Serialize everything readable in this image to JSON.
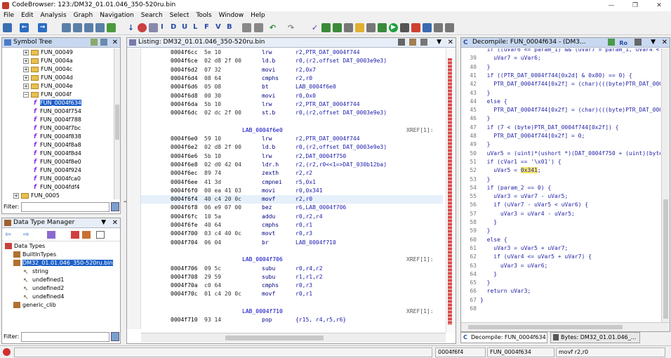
{
  "window": {
    "title": "CodeBrowser: 123:/DM32_01.01.046_350-520ru.bin",
    "min": "—",
    "max": "❐",
    "close": "✕"
  },
  "menu": [
    "File",
    "Edit",
    "Analysis",
    "Graph",
    "Navigation",
    "Search",
    "Select",
    "Tools",
    "Window",
    "Help"
  ],
  "toolbar_letters": [
    "I",
    "D",
    "U",
    "L",
    "F",
    "V",
    "B"
  ],
  "symbol_tree": {
    "title": "Symbol Tree",
    "rows": [
      {
        "label": "FUN_00049",
        "kind": "folder"
      },
      {
        "label": "FUN_0004a",
        "kind": "folder"
      },
      {
        "label": "FUN_0004c",
        "kind": "folder"
      },
      {
        "label": "FUN_0004d",
        "kind": "folder"
      },
      {
        "label": "FUN_0004e",
        "kind": "folder"
      },
      {
        "label": "FUN_0004f",
        "kind": "folder-open"
      },
      {
        "label": "FUN_0004f634",
        "kind": "fn",
        "selected": true
      },
      {
        "label": "FUN_0004f754",
        "kind": "fn"
      },
      {
        "label": "FUN_0004f788",
        "kind": "fn"
      },
      {
        "label": "FUN_0004f7bc",
        "kind": "fn"
      },
      {
        "label": "FUN_0004f838",
        "kind": "fn"
      },
      {
        "label": "FUN_0004f8a8",
        "kind": "fn"
      },
      {
        "label": "FUN_0004f8d4",
        "kind": "fn"
      },
      {
        "label": "FUN_0004f8e0",
        "kind": "fn"
      },
      {
        "label": "FUN_0004f924",
        "kind": "fn"
      },
      {
        "label": "FUN_0004fca0",
        "kind": "fn"
      },
      {
        "label": "FUN_0004fdf4",
        "kind": "fn"
      },
      {
        "label": "FUN_0005",
        "kind": "folder-top"
      }
    ],
    "filter_label": "Filter:"
  },
  "dtm": {
    "title": "Data Type Manager",
    "rows": [
      {
        "label": "Data Types"
      },
      {
        "label": "BuiltInTypes"
      },
      {
        "label": "DM32_01.01.046_350-520ru.bin",
        "selected": true
      },
      {
        "label": "string"
      },
      {
        "label": "undefined1"
      },
      {
        "label": "undefined2"
      },
      {
        "label": "undefined4"
      },
      {
        "label": "generic_clib"
      }
    ],
    "filter_label": "Filter:"
  },
  "listing": {
    "title": "Listing:  DM32_01.01.046_350-520ru.bin",
    "rows": [
      {
        "addr": "0004f6cc",
        "bytes": "5e 10",
        "mn": "lrw",
        "op": "r2,PTR_DAT_0004f744"
      },
      {
        "addr": "0004f6ce",
        "bytes": "02 d8 2f 00",
        "mn": "ld.b",
        "op": "r0,(r2,offset DAT_0003e9e3)"
      },
      {
        "addr": "0004f6d2",
        "bytes": "07 32",
        "mn": "movi",
        "op": "r2,0x7"
      },
      {
        "addr": "0004f6d4",
        "bytes": "08 64",
        "mn": "cmphs",
        "op": "r2,r0"
      },
      {
        "addr": "0004f6d6",
        "bytes": "05 08",
        "mn": "bt",
        "op": "LAB_0004f6e0"
      },
      {
        "addr": "0004f6d8",
        "bytes": "00 30",
        "mn": "movi",
        "op": "r0,0x0"
      },
      {
        "addr": "0004f6da",
        "bytes": "5b 10",
        "mn": "lrw",
        "op": "r2,PTR_DAT_0004f744"
      },
      {
        "addr": "0004f6dc",
        "bytes": "02 dc 2f 00",
        "mn": "st.b",
        "op": "r0,(r2,offset DAT_0003e9e3)"
      },
      {
        "blank": true
      },
      {
        "label": "LAB_0004f6e0",
        "xref": "XREF[1]:"
      },
      {
        "addr": "0004f6e0",
        "bytes": "59 10",
        "mn": "lrw",
        "op": "r2,PTR_DAT_0004f744"
      },
      {
        "addr": "0004f6e2",
        "bytes": "02 d8 2f 00",
        "mn": "ld.b",
        "op": "r0,(r2,offset DAT_0003e9e3)"
      },
      {
        "addr": "0004f6e6",
        "bytes": "5b 10",
        "mn": "lrw",
        "op": "r2,DAT_0004f750"
      },
      {
        "addr": "0004f6e8",
        "bytes": "02 d0 42 04",
        "mn": "ldr.h",
        "op": "r2,(r2,r0<<1=>DAT_030b12ba)"
      },
      {
        "addr": "0004f6ec",
        "bytes": "89 74",
        "mn": "zexth",
        "op": "r2,r2"
      },
      {
        "addr": "0004f6ee",
        "bytes": "41 3d",
        "mn": "cmpnei",
        "op": "r5,0x1"
      },
      {
        "addr": "0004f6f0",
        "bytes": "00 ea 41 03",
        "mn": "movi",
        "op": "r0,0x341"
      },
      {
        "addr": "0004f6f4",
        "bytes": "40 c4 20 0c",
        "mn": "movf",
        "op": "r2,r0",
        "current": true
      },
      {
        "addr": "0004f6f8",
        "bytes": "06 e9 07 00",
        "mn": "bez",
        "op": "r6,LAB_0004f706"
      },
      {
        "addr": "0004f6fc",
        "bytes": "10 5a",
        "mn": "addu",
        "op": "r0,r2,r4"
      },
      {
        "addr": "0004f6fe",
        "bytes": "40 64",
        "mn": "cmphs",
        "op": "r0,r1"
      },
      {
        "addr": "0004f700",
        "bytes": "03 c4 40 0c",
        "mn": "movt",
        "op": "r0,r3"
      },
      {
        "addr": "0004f704",
        "bytes": "06 04",
        "mn": "br",
        "op": "LAB_0004f710"
      },
      {
        "blank": true
      },
      {
        "label": "LAB_0004f706",
        "xref": "XREF[1]:"
      },
      {
        "addr": "0004f706",
        "bytes": "09 5c",
        "mn": "subu",
        "op": "r0,r4,r2"
      },
      {
        "addr": "0004f708",
        "bytes": "29 59",
        "mn": "subu",
        "op": "r1,r1,r2"
      },
      {
        "addr": "0004f70a",
        "bytes": "c0 64",
        "mn": "cmphs",
        "op": "r0,r3"
      },
      {
        "addr": "0004f70c",
        "bytes": "01 c4 20 0c",
        "mn": "movf",
        "op": "r0,r1"
      },
      {
        "blank": true
      },
      {
        "label": "LAB_0004f710",
        "xref": "XREF[1]:"
      },
      {
        "addr": "0004f710",
        "bytes": "93 14",
        "mn": "pop",
        "op": "{r15, r4,r5,r6}"
      }
    ]
  },
  "decompile": {
    "title": "Decompile: FUN_0004f634 - (DM3...",
    "lines": [
      {
        "n": "",
        "t": "  if ((uVar6 <= param_1) && (uVar7 = param_1, uVar4 < pa"
      },
      {
        "n": "39",
        "t": "    uVar7 = uVar6;"
      },
      {
        "n": "40",
        "t": "  }"
      },
      {
        "n": "41",
        "t": "  if ((PTR_DAT_0004f744[0x2d] & 0x80) == 0) {"
      },
      {
        "n": "42",
        "t": "    PTR_DAT_0004f744[0x2f] = (char)(((byte)PTR_DAT_0004f"
      },
      {
        "n": "43",
        "t": "  }"
      },
      {
        "n": "44",
        "t": "  else {"
      },
      {
        "n": "45",
        "t": "    PTR_DAT_0004f744[0x2f] = (char)(((byte)PTR_DAT_0004f"
      },
      {
        "n": "46",
        "t": "  }"
      },
      {
        "n": "47",
        "t": "  if (7 < (byte)PTR_DAT_0004f744[0x2f]) {"
      },
      {
        "n": "48",
        "t": "    PTR_DAT_0004f744[0x2f] = 0;"
      },
      {
        "n": "49",
        "t": "  }"
      },
      {
        "n": "50",
        "t": "  uVar5 = (uint)*(ushort *)(DAT_0004f750 + (uint)(byte)P"
      },
      {
        "n": "51",
        "t": "  if (cVar1 == '\\x01') {"
      },
      {
        "n": "52",
        "t": "    uVar5 = ",
        "hl": "0x341",
        "t2": ";"
      },
      {
        "n": "53",
        "t": "  }"
      },
      {
        "n": "54",
        "t": "  if (param_2 == 0) {"
      },
      {
        "n": "55",
        "t": "    uVar3 = uVar7 - uVar5;"
      },
      {
        "n": "56",
        "t": "    if (uVar7 - uVar5 < uVar6) {"
      },
      {
        "n": "57",
        "t": "      uVar3 = uVar4 - uVar5;"
      },
      {
        "n": "58",
        "t": "    }"
      },
      {
        "n": "59",
        "t": "  }"
      },
      {
        "n": "60",
        "t": "  else {"
      },
      {
        "n": "61",
        "t": "    uVar3 = uVar5 + uVar7;"
      },
      {
        "n": "62",
        "t": "    if (uVar4 <= uVar5 + uVar7) {"
      },
      {
        "n": "63",
        "t": "      uVar3 = uVar6;"
      },
      {
        "n": "64",
        "t": "    }"
      },
      {
        "n": "65",
        "t": "  }"
      },
      {
        "n": "66",
        "t": "  return uVar3;"
      },
      {
        "n": "67",
        "t": "}"
      },
      {
        "n": "68",
        "t": ""
      }
    ],
    "tab1": "Decompile: FUN_0004f634",
    "tab2": "Bytes: DM32_01.01.046_..."
  },
  "status": {
    "addr": "0004f6f4",
    "func": "FUN_0004f634",
    "instr": "movf r2,r0"
  }
}
